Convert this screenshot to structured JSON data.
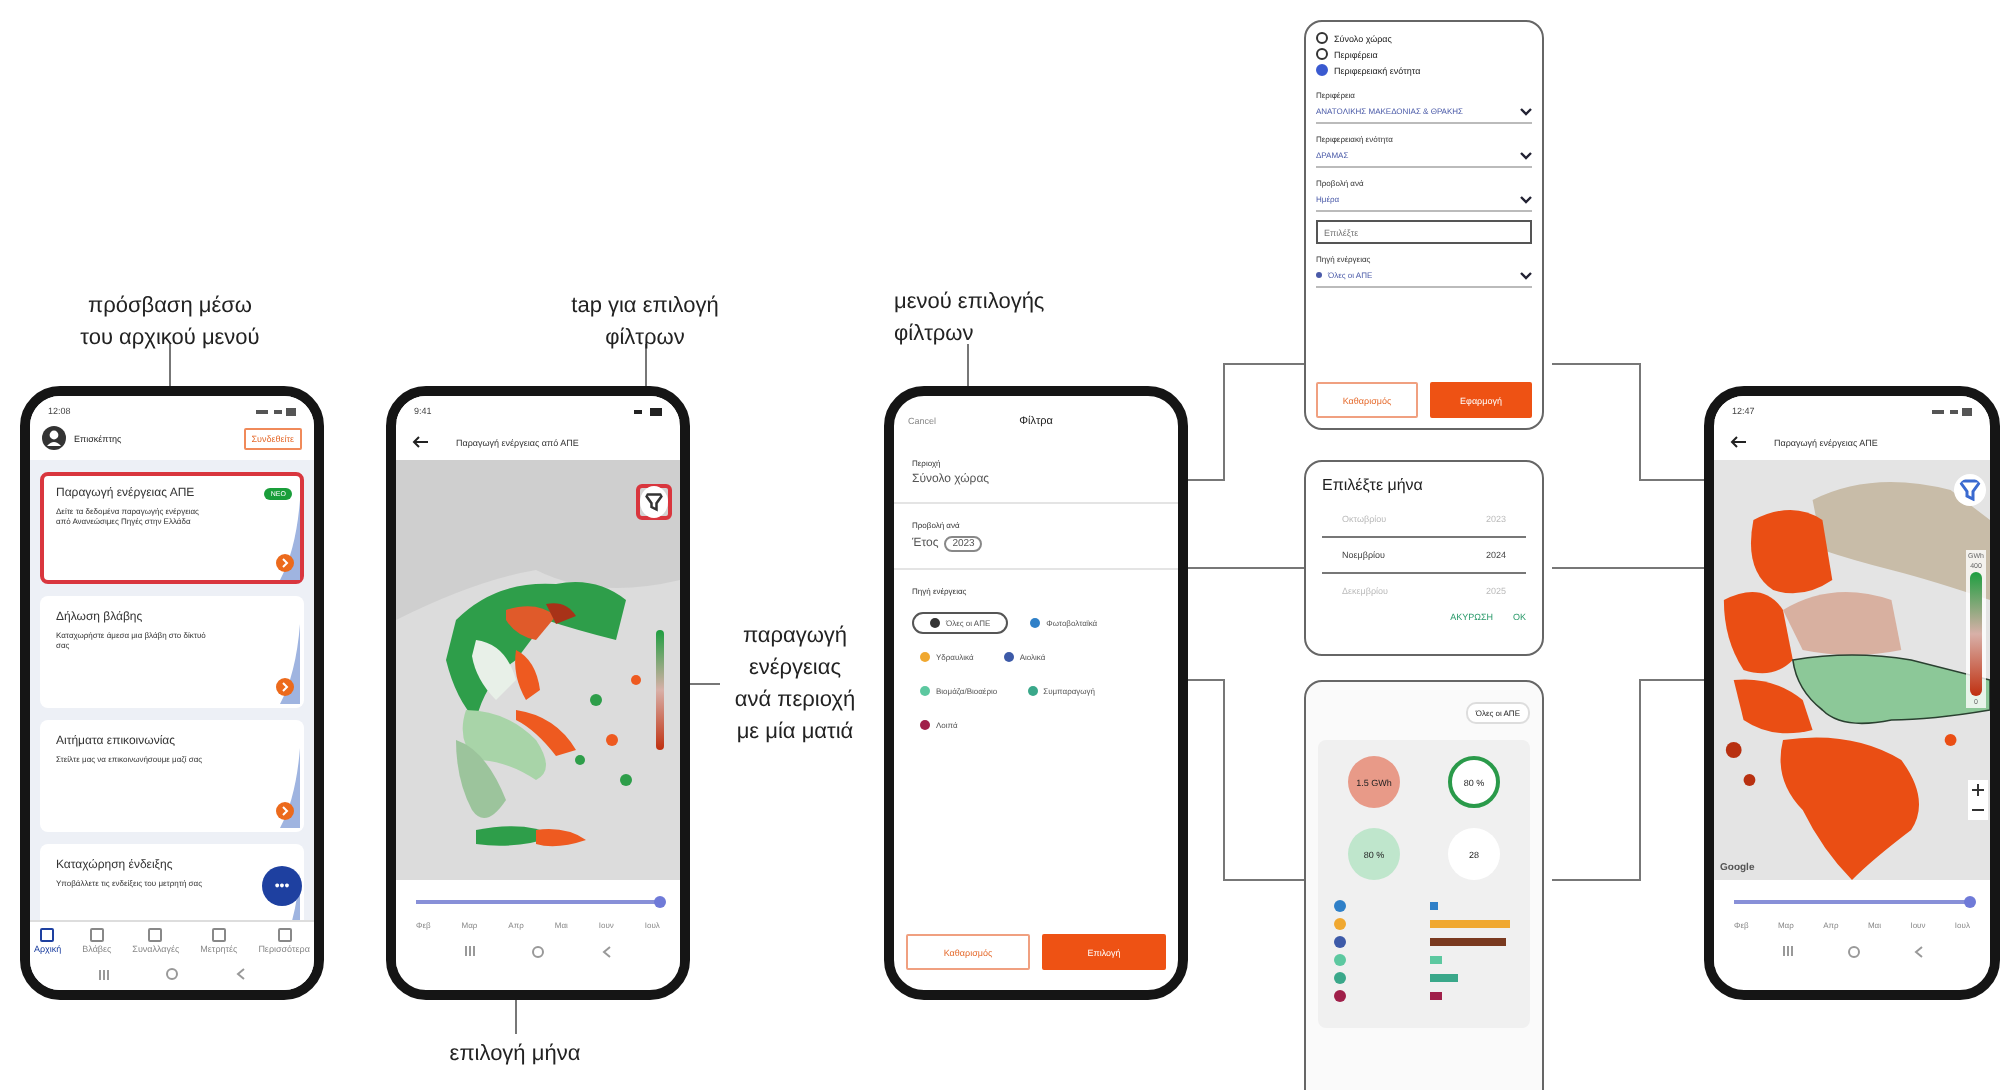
{
  "home_phone": {
    "caption": [
      "πρόσβαση μέσω",
      "του αρχικού μενού"
    ],
    "status_time": "12:08",
    "user": "Επισκέπτης",
    "login_button": "Συνδεθείτε",
    "cards": [
      {
        "title": "Παραγωγή ενέργειας ΑΠΕ",
        "badge": "NEO",
        "description": "Δείτε τα δεδομένα παραγωγής ενέργειας από Ανανεώσιμες Πηγές στην Ελλάδα",
        "selected": true
      },
      {
        "title": "Δήλωση βλάβης",
        "description": "Καταχωρήστε άμεσα μια βλάβη στο δίκτυό σας",
        "selected": false
      },
      {
        "title": "Αιτήματα επικοινωνίας",
        "description": "Στείλτε μας να επικοινωνήσουμε μαζί σας",
        "selected": false
      },
      {
        "title": "Καταχώρηση ένδειξης",
        "description": "Υποβάλλετε τις ενδείξεις του μετρητή σας",
        "selected": false
      }
    ],
    "chat_button": "•••",
    "nav": [
      {
        "label": "Αρχική",
        "selected": true
      },
      {
        "label": "Βλάβες",
        "selected": false
      },
      {
        "label": "Συναλλαγές",
        "selected": false
      },
      {
        "label": "Μετρητές",
        "selected": false
      },
      {
        "label": "Περισσότερα",
        "selected": false
      }
    ]
  },
  "map_phone": {
    "caption_filter": [
      "tap για επιλογή",
      "φίλτρων"
    ],
    "caption_map": [
      "παραγωγή",
      "ενέργειας",
      "ανά περιοχή",
      "με μία ματιά"
    ],
    "caption_month": "επιλογή μήνα",
    "status_time": "9:41",
    "title": "Παραγωγή ενέργειας από ΑΠΕ",
    "slider": {
      "level": 1
    },
    "months": [
      "Φεβ",
      "Μαρ",
      "Απρ",
      "Μαι",
      "Ιουν",
      "Ιουλ"
    ]
  },
  "filter_phone": {
    "caption": [
      "μενού επιλογής",
      "φίλτρων"
    ],
    "cancel": "Cancel",
    "title": "Φίλτρα",
    "region_label": "Περιοχή",
    "region_value": "Σύνολο χώρας",
    "view_label": "Προβολή ανά",
    "view_value": "Έτος",
    "year": "2023",
    "source_label": "Πηγή ενέργειας",
    "sources": [
      {
        "label": "Όλες οι ΑΠΕ",
        "selected": true,
        "color": "#333333"
      },
      {
        "label": "Φωτοβολταϊκά",
        "selected": false,
        "color": "#2f80c8"
      },
      {
        "label": "Υδραυλικά",
        "selected": false,
        "color": "#f0a830"
      },
      {
        "label": "Αιολικά",
        "selected": false,
        "color": "#3d5aa8"
      },
      {
        "label": "Βιομάζα/Βιοαέριο",
        "selected": false,
        "color": "#5cc8a0"
      },
      {
        "label": "Συμπαραγωγή",
        "selected": false,
        "color": "#3aa88a"
      },
      {
        "label": "Λοιπά",
        "selected": false,
        "color": "#a0204a"
      }
    ],
    "clear_button": "Καθαρισμός",
    "apply_button": "Επιλογή"
  },
  "region_sheet": {
    "options": [
      {
        "label": "Σύνολο χώρας",
        "selected": false
      },
      {
        "label": "Περιφέρεια",
        "selected": false
      },
      {
        "label": "Περιφερειακή ενότητα",
        "selected": true
      }
    ],
    "dropdowns": [
      {
        "label": "Περιφέρεια",
        "value": "ΑΝΑΤΟΛΙΚΗΣ ΜΑΚΕΔΟΝΙΑΣ & ΘΡΑΚΗΣ"
      },
      {
        "label": "Περιφερειακή ενότητα",
        "value": "ΔΡΑΜΑΣ"
      },
      {
        "label": "Προβολή ανά",
        "value": "Ημέρα"
      }
    ],
    "date_placeholder": "Επιλέξτε",
    "source_label": "Πηγή ενέργειας",
    "source_value": "Όλες οι ΑΠΕ",
    "clear_button": "Καθαρισμός",
    "apply_button": "Εφαρμογή"
  },
  "month_picker": {
    "title": "Επιλέξτε μήνα",
    "rows": [
      {
        "month": "Οκτωβρίου",
        "year": "2023",
        "selected": false
      },
      {
        "month": "Νοεμβρίου",
        "year": "2024",
        "selected": true
      },
      {
        "month": "Δεκεμβρίου",
        "year": "2025",
        "selected": false
      }
    ],
    "cancel": "ΑΚΥΡΩΣΗ",
    "ok": "ΟΚ"
  },
  "dashboard": {
    "chip": "Όλες οι ΑΠΕ",
    "stats": [
      "1.5 GWh",
      "80 %",
      "80 %",
      "28"
    ]
  },
  "result_phone": {
    "status_time": "12:47",
    "title": "Παραγωγή ενέργειας ΑΠΕ",
    "legend_unit": "GWh",
    "legend_max": "400",
    "legend_min": "0",
    "map_credit": "Google",
    "slider": {
      "level": 1
    },
    "months": [
      "Φεβ",
      "Μαρ",
      "Απρ",
      "Μαι",
      "Ιουν",
      "Ιουλ"
    ]
  }
}
